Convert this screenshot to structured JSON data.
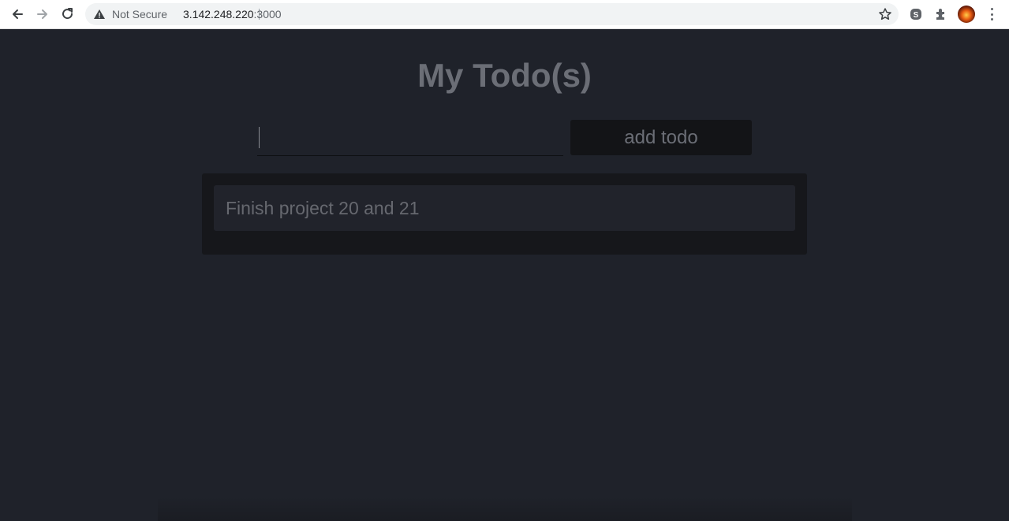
{
  "browser": {
    "security_label": "Not Secure",
    "url_host": "3.142.248.220",
    "url_port": ":3000"
  },
  "app": {
    "title": "My Todo(s)",
    "input": {
      "value": "",
      "placeholder": ""
    },
    "add_button_label": "add todo",
    "todos": [
      {
        "text": "Finish project 20 and 21"
      }
    ]
  },
  "colors": {
    "page_background": "#1f222a",
    "panel_background": "#16171b",
    "item_background": "#21232b",
    "text_muted": "#6b6e76"
  },
  "icons": [
    "back-arrow-icon",
    "forward-arrow-icon",
    "reload-icon",
    "warning-icon",
    "star-icon",
    "skype-icon",
    "puzzle-extension-icon",
    "profile-avatar",
    "kebab-menu-icon"
  ]
}
